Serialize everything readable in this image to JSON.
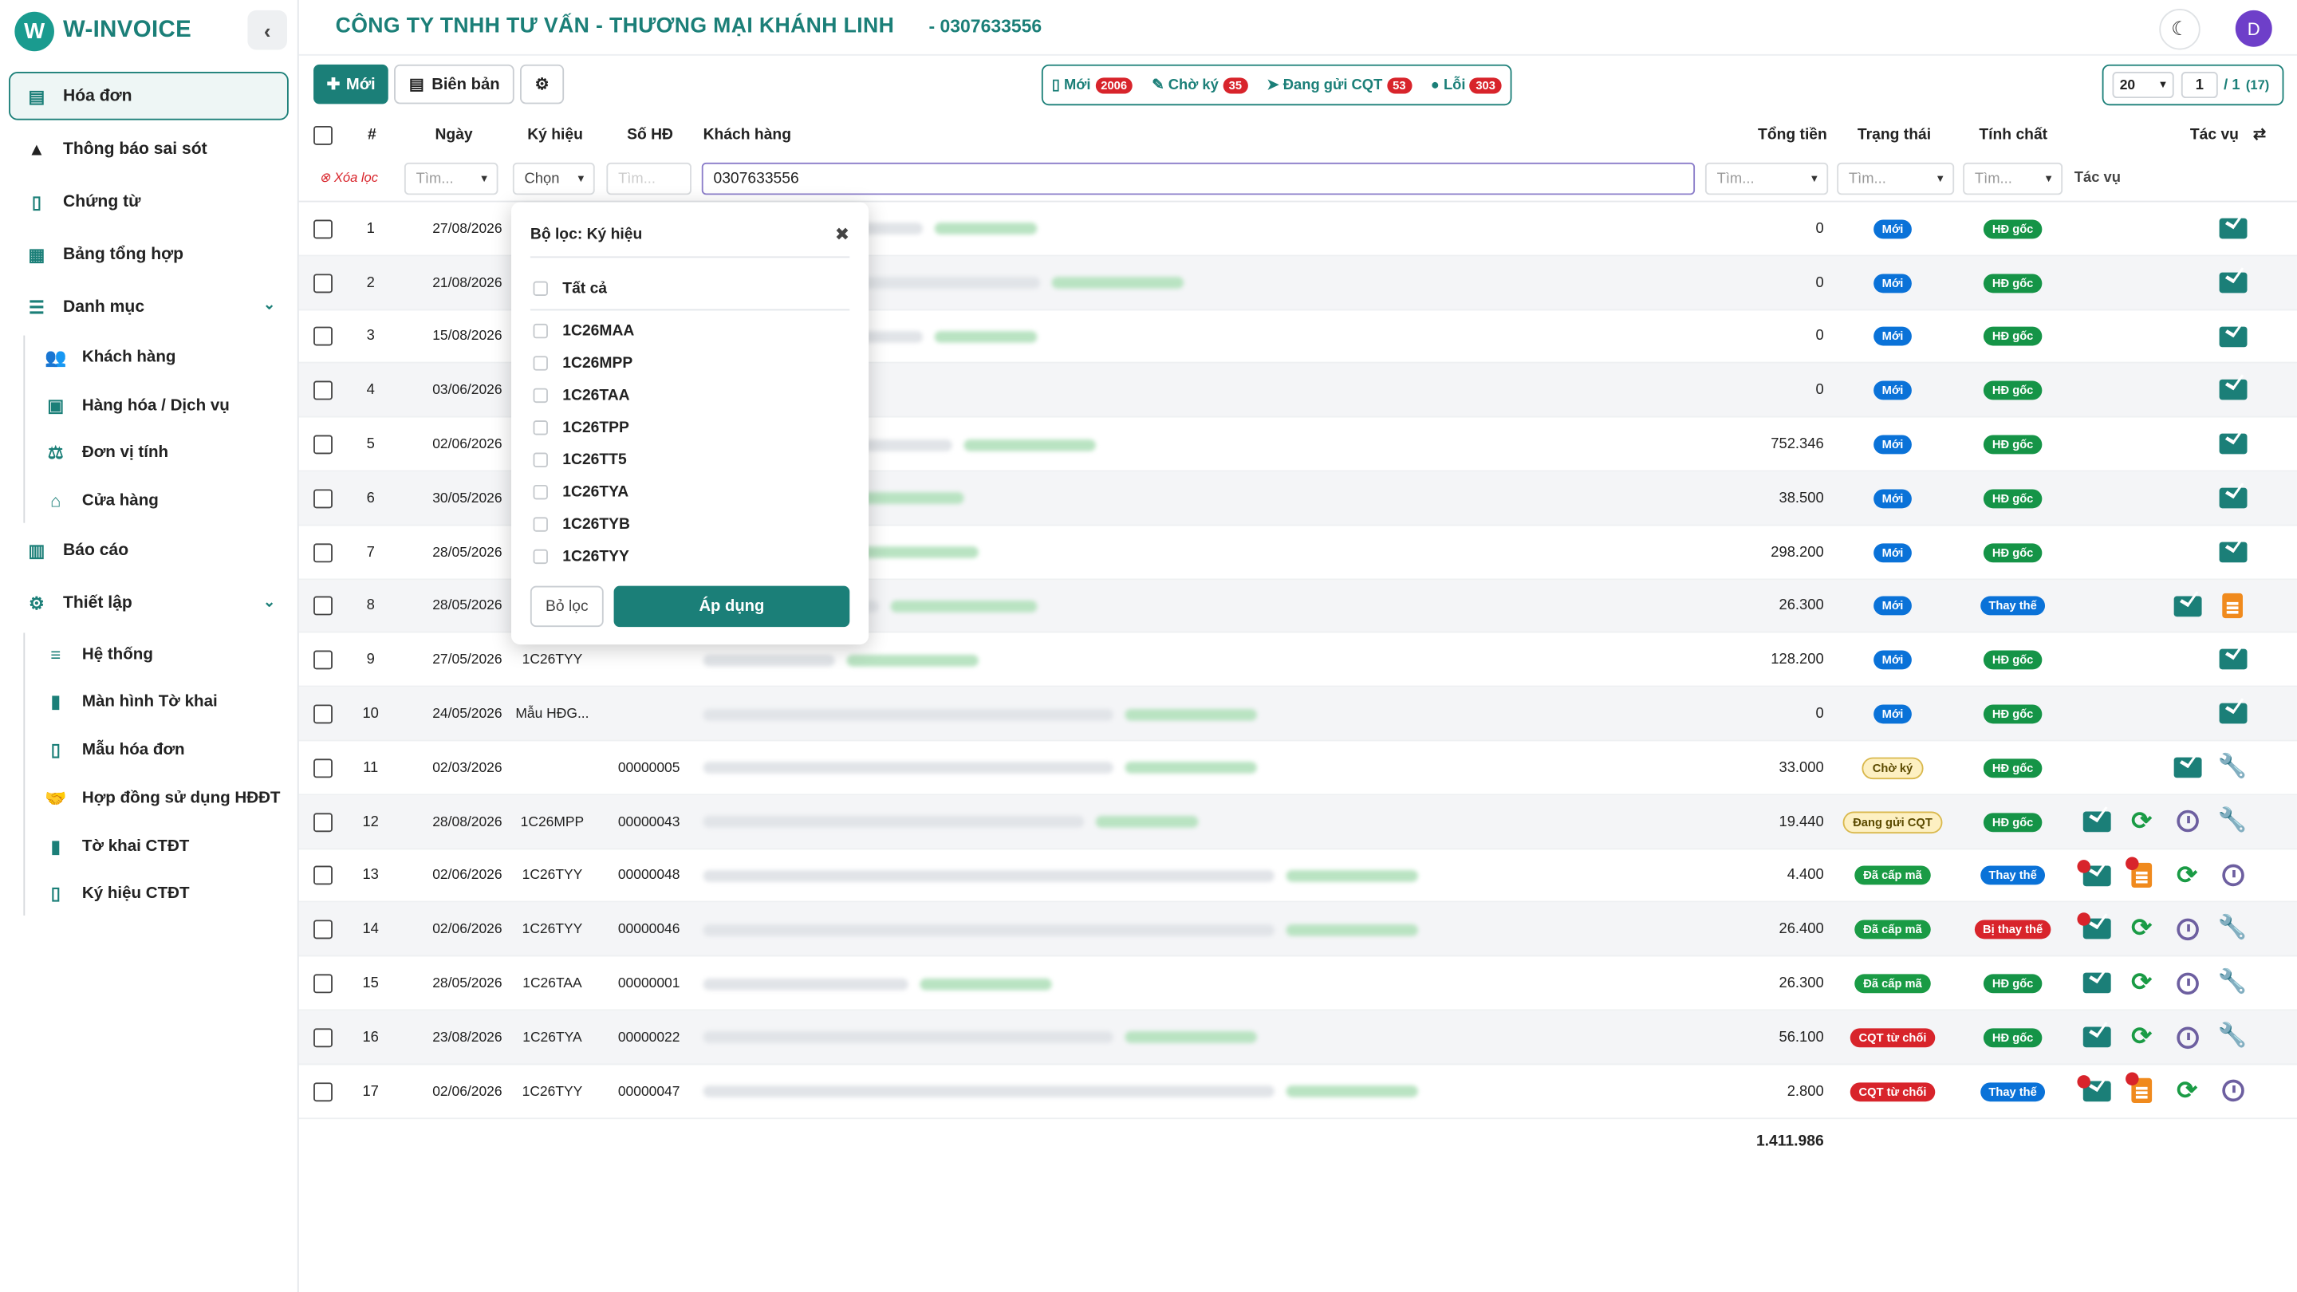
{
  "sidebar": {
    "brand": "W-INVOICE",
    "items": [
      {
        "label": "Hóa đơn",
        "icon": "invoice-icon"
      },
      {
        "label": "Thông báo sai sót",
        "icon": "warning-icon"
      },
      {
        "label": "Chứng từ",
        "icon": "document-icon"
      },
      {
        "label": "Bảng tổng hợp",
        "icon": "table-icon"
      },
      {
        "label": "Danh mục",
        "icon": "list-icon"
      },
      {
        "label": "Báo cáo",
        "icon": "chart-icon"
      },
      {
        "label": "Thiết lập",
        "icon": "gears-icon"
      }
    ],
    "danh_muc": [
      "Khách hàng",
      "Hàng hóa / Dịch vụ",
      "Đơn vị tính",
      "Cửa hàng"
    ],
    "thiet_lap": [
      "Hệ thống",
      "Màn hình Tờ khai",
      "Mẫu hóa đơn",
      "Hợp đồng sử dụng HĐĐT",
      "Tờ khai CTĐT",
      "Ký hiệu CTĐT"
    ]
  },
  "header": {
    "company": "CÔNG TY TNHH TƯ VẤN - THƯƠNG MẠI KHÁNH LINH",
    "tax_id": "- 0307633556",
    "avatar": "D"
  },
  "toolbar": {
    "new": "Mới",
    "report": "Biên bản"
  },
  "status": [
    {
      "label": "Mới",
      "count": "2006"
    },
    {
      "label": "Chờ ký",
      "count": "35"
    },
    {
      "label": "Đang gửi CQT",
      "count": "53"
    },
    {
      "label": "Lỗi",
      "count": "303"
    }
  ],
  "pager": {
    "size": "20",
    "page": "1",
    "total": "/ 1",
    "count": "(17)"
  },
  "columns": {
    "num": "#",
    "date": "Ngày",
    "symbol": "Ký hiệu",
    "invoice_no": "Số HĐ",
    "customer": "Khách hàng",
    "total": "Tổng tiền",
    "status": "Trạng thái",
    "nature": "Tính chất",
    "actions": "Tác vụ"
  },
  "filters": {
    "clear": "Xóa lọc",
    "search": "Tìm...",
    "choose": "Chọn",
    "customer_value": "0307633556",
    "actions": "Tác vụ"
  },
  "rows": [
    {
      "n": "1",
      "date": "27/08/2026",
      "sym": "",
      "no": "",
      "total": "0",
      "status": "Mới",
      "nature": "HĐ gốc"
    },
    {
      "n": "2",
      "date": "21/08/2026",
      "sym": "",
      "no": "",
      "total": "0",
      "status": "Mới",
      "nature": "HĐ gốc"
    },
    {
      "n": "3",
      "date": "15/08/2026",
      "sym": "",
      "no": "",
      "total": "0",
      "status": "Mới",
      "nature": "HĐ gốc"
    },
    {
      "n": "4",
      "date": "03/06/2026",
      "sym": "",
      "no": "",
      "total": "0",
      "status": "Mới",
      "nature": "HĐ gốc"
    },
    {
      "n": "5",
      "date": "02/06/2026",
      "sym": "",
      "no": "",
      "total": "752.346",
      "status": "Mới",
      "nature": "HĐ gốc"
    },
    {
      "n": "6",
      "date": "30/05/2026",
      "sym": "",
      "no": "",
      "total": "38.500",
      "status": "Mới",
      "nature": "HĐ gốc"
    },
    {
      "n": "7",
      "date": "28/05/2026",
      "sym": "",
      "no": "",
      "total": "298.200",
      "status": "Mới",
      "nature": "HĐ gốc"
    },
    {
      "n": "8",
      "date": "28/05/2026",
      "sym": "",
      "no": "",
      "total": "26.300",
      "status": "Mới",
      "nature": "Thay thế"
    },
    {
      "n": "9",
      "date": "27/05/2026",
      "sym": "1C26TYY",
      "no": "",
      "total": "128.200",
      "status": "Mới",
      "nature": "HĐ gốc"
    },
    {
      "n": "10",
      "date": "24/05/2026",
      "sym": "Mẫu HĐG...",
      "no": "",
      "total": "0",
      "status": "Mới",
      "nature": "HĐ gốc"
    },
    {
      "n": "11",
      "date": "02/03/2026",
      "sym": "",
      "no": "00000005",
      "total": "33.000",
      "status": "Chờ ký",
      "nature": "HĐ gốc"
    },
    {
      "n": "12",
      "date": "28/08/2026",
      "sym": "1C26MPP",
      "no": "00000043",
      "total": "19.440",
      "status": "Đang gửi CQT",
      "nature": "HĐ gốc"
    },
    {
      "n": "13",
      "date": "02/06/2026",
      "sym": "1C26TYY",
      "no": "00000048",
      "total": "4.400",
      "status": "Đã cấp mã",
      "nature": "Thay thế"
    },
    {
      "n": "14",
      "date": "02/06/2026",
      "sym": "1C26TYY",
      "no": "00000046",
      "total": "26.400",
      "status": "Đã cấp mã",
      "nature": "Bị thay thế"
    },
    {
      "n": "15",
      "date": "28/05/2026",
      "sym": "1C26TAA",
      "no": "00000001",
      "total": "26.300",
      "status": "Đã cấp mã",
      "nature": "HĐ gốc"
    },
    {
      "n": "16",
      "date": "23/08/2026",
      "sym": "1C26TYA",
      "no": "00000022",
      "total": "56.100",
      "status": "CQT từ chối",
      "nature": "HĐ gốc"
    },
    {
      "n": "17",
      "date": "02/06/2026",
      "sym": "1C26TYY",
      "no": "00000047",
      "total": "2.800",
      "status": "CQT từ chối",
      "nature": "Thay thế"
    }
  ],
  "grand_total": "1.411.986",
  "popup": {
    "title": "Bộ lọc: Ký hiệu",
    "all": "Tất cả",
    "options": [
      "1C26MAA",
      "1C26MPP",
      "1C26TAA",
      "1C26TPP",
      "1C26TT5",
      "1C26TYA",
      "1C26TYB",
      "1C26TYY"
    ],
    "reset": "Bỏ lọc",
    "apply": "Áp dụng"
  }
}
